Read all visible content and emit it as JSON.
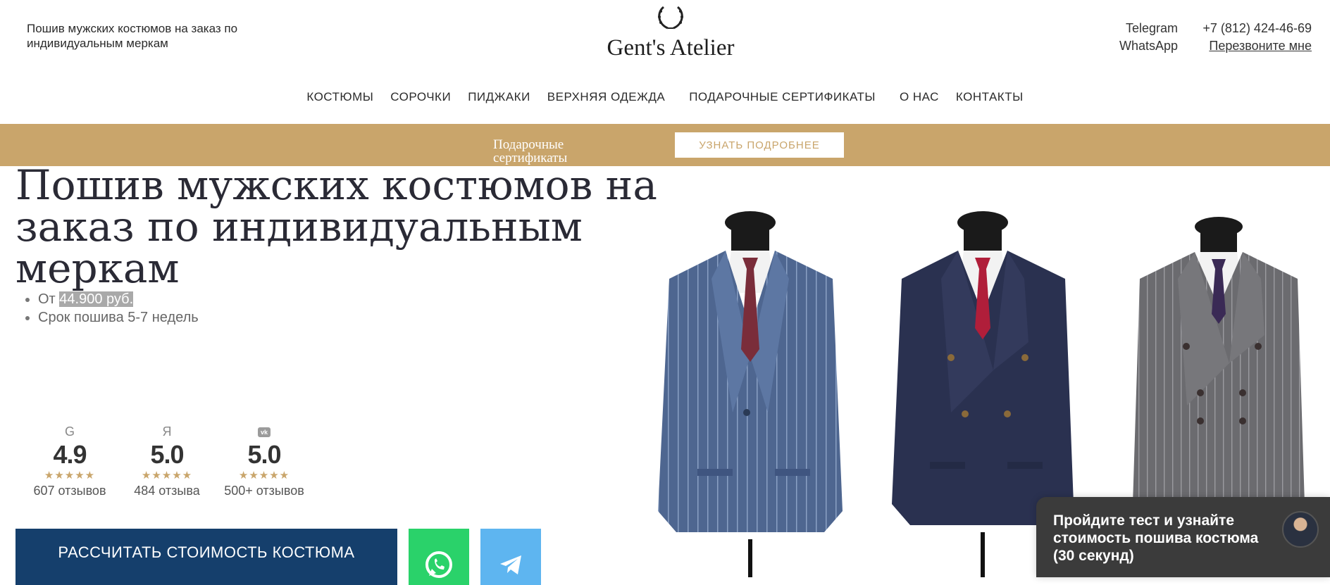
{
  "header": {
    "tagline": "Пошив мужских костюмов на заказ по индивидуальным меркам",
    "logo_text": "Gent's Atelier",
    "telegram": "Telegram",
    "whatsapp": "WhatsApp",
    "phone": "+7 (812) 424-46-69",
    "callback": "Перезвоните мне"
  },
  "nav": [
    "КОСТЮМЫ",
    "СОРОЧКИ",
    "ПИДЖАКИ",
    "ВЕРХНЯЯ ОДЕЖДА",
    "ПОДАРОЧНЫЕ СЕРТИФИКАТЫ",
    "О НАС",
    "КОНТАКТЫ"
  ],
  "promo": {
    "text": "Подарочные сертификаты",
    "button": "УЗНАТЬ ПОДРОБНЕЕ",
    "color": "#c9a56b"
  },
  "hero": {
    "title": "Пошив мужских костюмов на заказ по индивидуальным меркам",
    "bullet_price_prefix": "От ",
    "bullet_price": "44.900 руб.",
    "bullet_term": "Срок пошива 5-7 недель"
  },
  "ratings": [
    {
      "source": "G",
      "icon": "google-icon",
      "score": "4.9",
      "stars": "★★★★★",
      "count": "607 отзывов"
    },
    {
      "source": "Я",
      "icon": "yandex-icon",
      "score": "5.0",
      "stars": "★★★★★",
      "count": "484 отзыва"
    },
    {
      "source": "vk",
      "icon": "vk-icon",
      "score": "5.0",
      "stars": "★★★★★",
      "count": "500+ отзывов"
    }
  ],
  "cta": {
    "label": "РАССЧИТАТЬ СТОИМОСТЬ КОСТЮМА",
    "color": "#153f6c"
  },
  "messengers": [
    {
      "icon": "whatsapp-icon",
      "color": "#2ad26a"
    },
    {
      "icon": "telegram-icon",
      "color": "#5eb5f0"
    }
  ],
  "quiz": {
    "text": "Пройдите тест и узнайте стоимость пошива костюма (30 секунд)"
  }
}
